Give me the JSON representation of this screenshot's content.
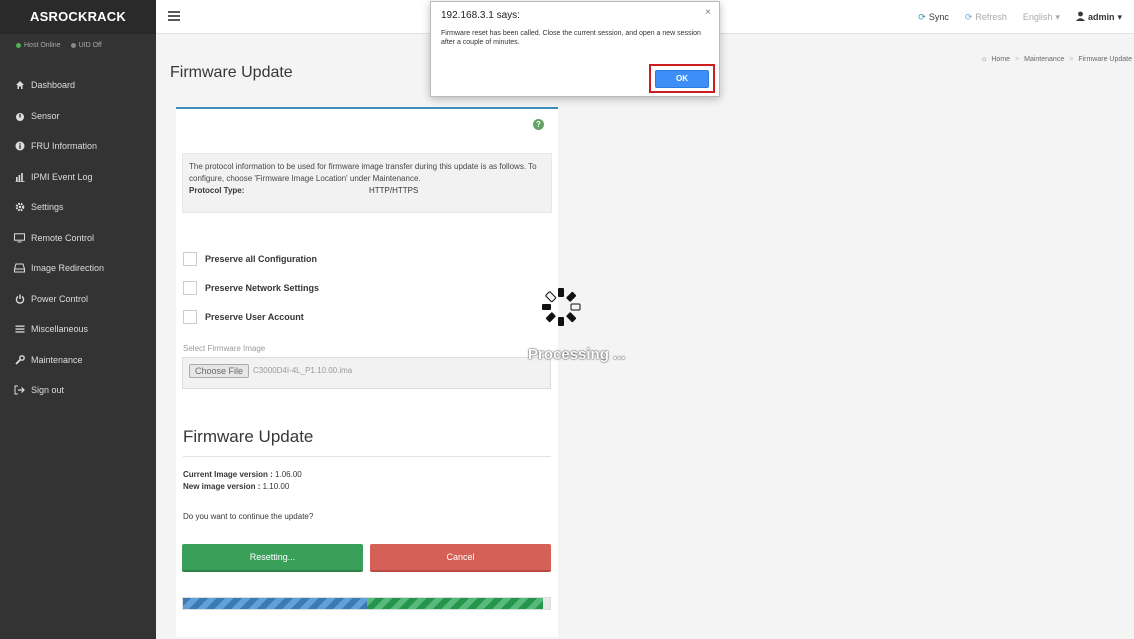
{
  "brand": "ASROCKRACK",
  "status": {
    "host": "Host Online",
    "uid": "UID Off"
  },
  "nav": [
    {
      "label": "Dashboard",
      "icon": "home-icon"
    },
    {
      "label": "Sensor",
      "icon": "sensor-icon"
    },
    {
      "label": "FRU Information",
      "icon": "info-icon"
    },
    {
      "label": "IPMI Event Log",
      "icon": "chart-icon"
    },
    {
      "label": "Settings",
      "icon": "gear-icon"
    },
    {
      "label": "Remote Control",
      "icon": "monitor-icon"
    },
    {
      "label": "Image Redirection",
      "icon": "drive-icon"
    },
    {
      "label": "Power Control",
      "icon": "power-icon"
    },
    {
      "label": "Miscellaneous",
      "icon": "list-icon"
    },
    {
      "label": "Maintenance",
      "icon": "wrench-icon"
    },
    {
      "label": "Sign out",
      "icon": "signout-icon"
    }
  ],
  "topbar": {
    "sync": "Sync",
    "refresh": "Refresh",
    "language": "English",
    "user": "admin"
  },
  "page": {
    "title": "Firmware Update",
    "breadcrumb": [
      "Home",
      "Maintenance",
      "Firmware Update"
    ]
  },
  "panel": {
    "info_text": "The protocol information to be used for firmware image transfer during this update is as follows. To configure, choose 'Firmware Image Location' under Maintenance.",
    "protocol_label": "Protocol Type:",
    "protocol_value": "HTTP/HTTPS",
    "preserve_config": "Preserve all Configuration",
    "preserve_network": "Preserve Network Settings",
    "preserve_user": "Preserve User Account",
    "select_label": "Select Firmware Image",
    "choose_file": "Choose File",
    "file_name": "C3000D4I-4L_P1.10.00.ima",
    "subtitle": "Firmware Update",
    "current_label": "Current Image version :",
    "current_value": "1.06.00",
    "new_label": "New image version :",
    "new_value": "1.10.00",
    "question": "Do you want to continue the update?",
    "reset_button": "Resetting...",
    "cancel_button": "Cancel",
    "progress_blue_fraction": 0.5,
    "progress_green_fraction": 0.98
  },
  "overlay": {
    "processing": "Processing ..."
  },
  "dialog": {
    "title": "192.168.3.1 says:",
    "message": "Firmware reset has been called. Close the current session, and open a new session after a couple of minutes.",
    "ok": "OK",
    "close": "×"
  },
  "colors": {
    "sidebar": "#2f2f2f",
    "accent": "#3c8dbc",
    "reset": "#2c9a4e",
    "cancel": "#d2554a",
    "ok": "#3e8ef7",
    "highlight": "#cc1e1e"
  }
}
